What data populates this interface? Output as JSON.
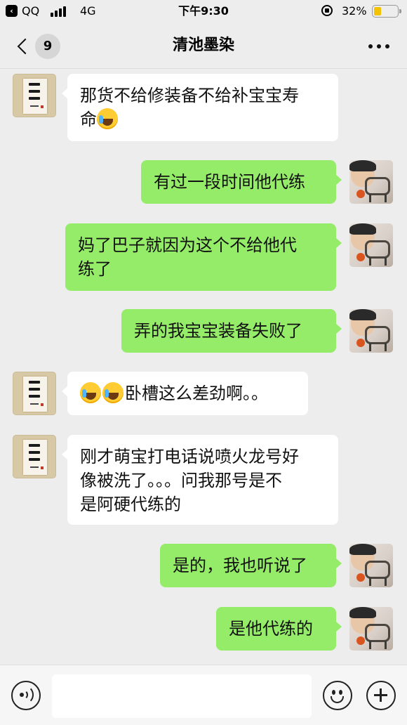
{
  "status_bar": {
    "back_app": "QQ",
    "carrier": "QQ",
    "network": "4G",
    "time": "下午9:30",
    "battery_percent": "32%",
    "battery_level": 0.32
  },
  "nav": {
    "unread_count": "9",
    "title": "清池墨染"
  },
  "messages": [
    {
      "side": "left",
      "parts": [
        "那货不给修装备不给补宝宝寿",
        "命",
        "[emoji:laugh-cry]"
      ]
    },
    {
      "side": "right",
      "parts": [
        "有过一段时间他代练"
      ]
    },
    {
      "side": "right",
      "parts": [
        "妈了巴子就因为这个不给他代",
        "练了"
      ]
    },
    {
      "side": "right",
      "parts": [
        "弄的我宝宝装备失败了"
      ]
    },
    {
      "side": "left",
      "parts": [
        "[emoji:laugh-cry]",
        "[emoji:laugh-cry]",
        "卧槽这么差劲啊。。"
      ]
    },
    {
      "side": "left",
      "parts": [
        "刚才萌宝打电话说喷火龙号好",
        "像被洗了。。。问我那号是不",
        "是阿硬代练的"
      ]
    },
    {
      "side": "right",
      "parts": [
        "是的，我也听说了"
      ]
    },
    {
      "side": "right",
      "parts": [
        "是他代练的"
      ]
    }
  ],
  "text": {
    "m1_line1": "那货不给修装备不给补宝宝寿",
    "m1_line2": "命",
    "m2": "有过一段时间他代练",
    "m3_line1": "妈了巴子就因为这个不给他代",
    "m3_line2": "练了",
    "m4": "弄的我宝宝装备失败了",
    "m5": "卧槽这么差劲啊。。",
    "m6_line1": "刚才萌宝打电话说喷火龙号好",
    "m6_line2": "像被洗了。。。问我那号是不",
    "m6_line3": "是阿硬代练的",
    "m7": "是的，我也听说了",
    "m8": "是他代练的"
  },
  "input_bar": {
    "placeholder": "",
    "icons": [
      "voice-icon",
      "emoji-icon",
      "plus-icon"
    ]
  },
  "colors": {
    "background": "#ededed",
    "sent_bubble": "#95ec69",
    "received_bubble": "#ffffff",
    "battery": "#f5c200"
  }
}
